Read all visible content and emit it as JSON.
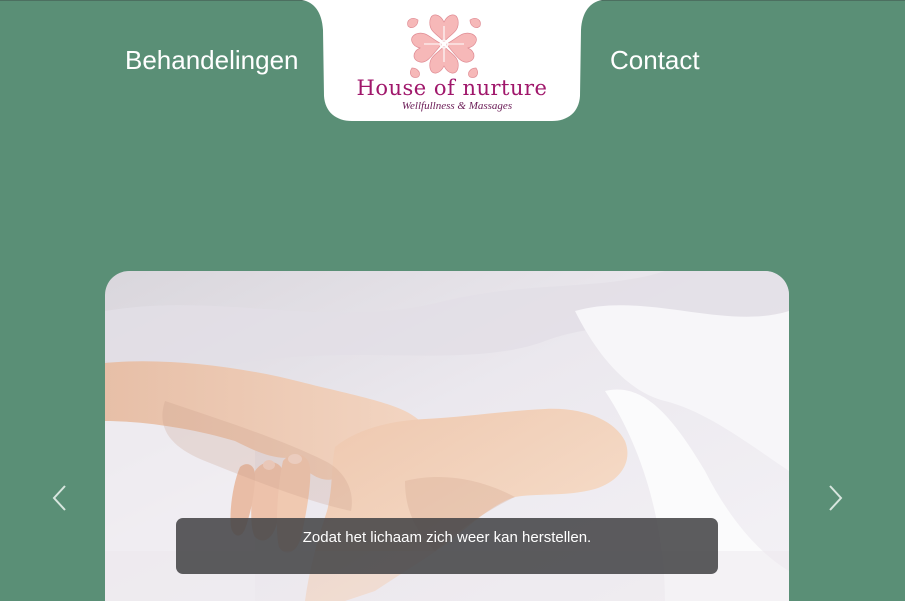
{
  "nav": {
    "left_label": "Behandelingen",
    "right_label": "Contact"
  },
  "logo": {
    "title": "House of nurture",
    "subtitle": "Wellfullness & Massages",
    "emblem_icon": "flower-emblem-icon"
  },
  "carousel": {
    "caption": "Zodat het lichaam zich weer kan herstellen.",
    "prev_icon": "chevron-left-icon",
    "next_icon": "chevron-right-icon"
  },
  "colors": {
    "background": "#5a8f76",
    "logo_text": "#a0176b",
    "emblem": "#f6b6b6",
    "caption_bg": "#464648"
  }
}
